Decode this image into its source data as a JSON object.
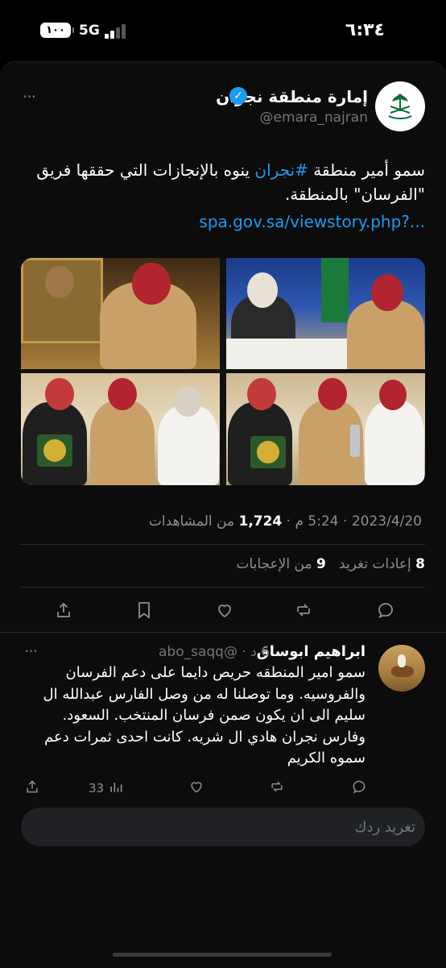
{
  "status_bar": {
    "time": "٦:٣٤",
    "network": "5G",
    "battery": "١٠٠"
  },
  "tweet": {
    "display_name": "إمارة منطقة نجران",
    "handle": "@emara_najran",
    "text_part1": "سمو أمير منطقة ",
    "hashtag": "#نجران",
    "text_part2": " ينوه بالإنجازات التي حققها فريق \"الفرسان\" بالمنطقة.",
    "link": "spa.gov.sa/viewstory.php?...",
    "date": "2023/4/20",
    "time": "5:24 م",
    "views_count": "1,724",
    "views_label": "من المشاهدات",
    "retweets_count": "8",
    "retweets_label": "إعادات تغريد",
    "likes_count": "9",
    "likes_label": "من الإعجابات",
    "more": "···"
  },
  "icons": {
    "reply": "reply-icon",
    "retweet": "retweet-icon",
    "like": "heart-icon",
    "bookmark": "bookmark-icon",
    "share": "share-icon",
    "views": "views-icon",
    "verified": "verified-badge-icon"
  },
  "reply": {
    "name": "ابراهيم ابوساق",
    "handle": "@abo_saqq",
    "age": "6 د",
    "text": "سمو امير المنطقه حريص دايما على دعم الفرسان والفروسيه. وما توصلنا له من وصل الفارس عبدالله ال سليم الى ان يكون صمن فرسان المنتخب. السعود. وفارس نجران هادي ال شريه. كانت احدى ثمرات دعم سموه الكريم",
    "views": "33",
    "more": "···"
  },
  "compose": {
    "placeholder": "تغريد ردك"
  },
  "colors": {
    "accent": "#1d9bf0",
    "background": "#000000",
    "text": "#e7e9ea",
    "muted": "#71767b"
  }
}
